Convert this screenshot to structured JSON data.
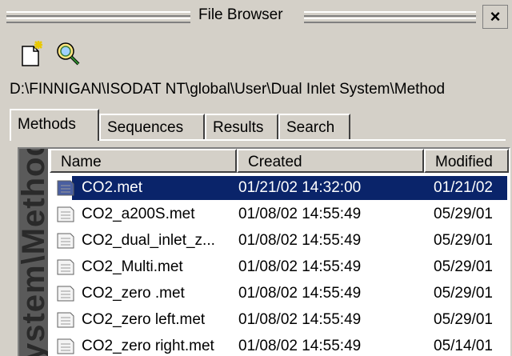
{
  "window": {
    "title": "File Browser",
    "close_glyph": "×"
  },
  "toolbar": {
    "new_icon": "new-document-icon",
    "search_icon": "magnifier-icon"
  },
  "path": "D:\\FINNIGAN\\ISODAT NT\\global\\User\\Dual Inlet System\\Method",
  "tabs": [
    {
      "label": "Methods",
      "active": true
    },
    {
      "label": "Sequences",
      "active": false
    },
    {
      "label": "Results",
      "active": false
    },
    {
      "label": "Search",
      "active": false
    }
  ],
  "sidebar_caption": "ystem\\Method",
  "columns": {
    "name": "Name",
    "created": "Created",
    "modified": "Modified"
  },
  "files": [
    {
      "name": "CO2.met",
      "created": "01/21/02 14:32:00",
      "modified": "01/21/02",
      "selected": true
    },
    {
      "name": "CO2_a200S.met",
      "created": "01/08/02 14:55:49",
      "modified": "05/29/01",
      "selected": false
    },
    {
      "name": "CO2_dual_inlet_z...",
      "created": "01/08/02 14:55:49",
      "modified": "05/29/01",
      "selected": false
    },
    {
      "name": "CO2_Multi.met",
      "created": "01/08/02 14:55:49",
      "modified": "05/29/01",
      "selected": false
    },
    {
      "name": "CO2_zero .met",
      "created": "01/08/02 14:55:49",
      "modified": "05/29/01",
      "selected": false
    },
    {
      "name": "CO2_zero left.met",
      "created": "01/08/02 14:55:49",
      "modified": "05/29/01",
      "selected": false
    },
    {
      "name": "CO2_zero right.met",
      "created": "01/08/02 14:55:49",
      "modified": "05/14/01",
      "selected": false
    }
  ],
  "colors": {
    "selection": "#0a246a",
    "chrome": "#d4d0c8",
    "sidebar": "#5a5a5a"
  }
}
